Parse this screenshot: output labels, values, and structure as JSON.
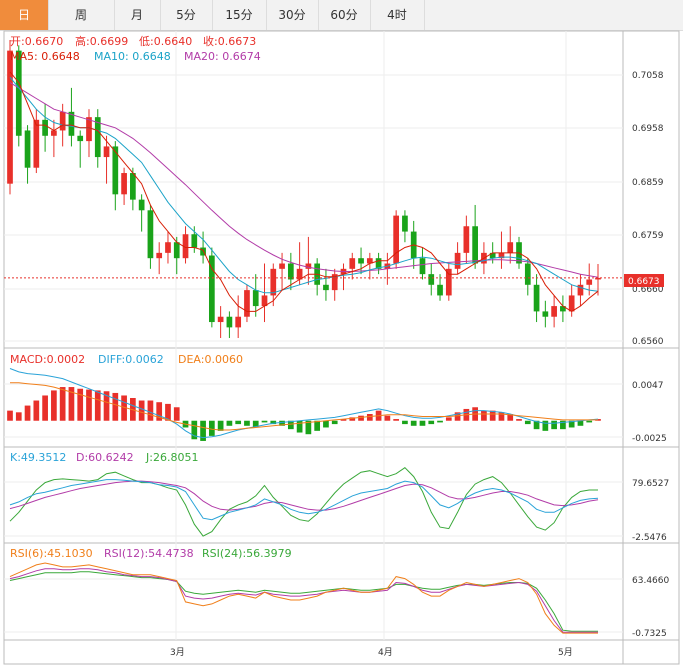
{
  "tabs": {
    "items": [
      "日",
      "周",
      "月",
      "5分",
      "15分",
      "30分",
      "60分",
      "4时"
    ],
    "active_index": 0
  },
  "colors": {
    "up": "#e8302a",
    "down": "#1aa31a",
    "active_tab": "#f08c3c",
    "ma5": "#d81e06",
    "ma10": "#1ba3c8",
    "ma20": "#b23ca8",
    "diff": "#2aa3d8",
    "dea": "#f07f1a",
    "k": "#2aa3d8",
    "d": "#b23ca8",
    "j": "#3aa83a",
    "rsi6": "#f07f1a",
    "rsi12": "#b23ca8",
    "rsi24": "#3aa83a"
  },
  "price_panel": {
    "labels": {
      "open": "开:0.6670",
      "high": "高:0.6699",
      "low": "低:0.6640",
      "close": "收:0.6673",
      "ma5": "MA5: 0.6648",
      "ma10": "MA10: 0.6648",
      "ma20": "MA20: 0.6674"
    },
    "y_ticks": [
      "0.7058",
      "0.6958",
      "0.6859",
      "0.6759",
      "0.6660",
      "0.6560"
    ],
    "current_price": "0.6673"
  },
  "macd_panel": {
    "labels": {
      "macd": "MACD:0.0002",
      "diff": "DIFF:0.0062",
      "dea": "DEA:0.0060"
    },
    "y_ticks": [
      "0.0047",
      "-0.0025"
    ]
  },
  "kdj_panel": {
    "labels": {
      "k": "K:49.3512",
      "d": "D:60.6242",
      "j": "J:26.8051"
    },
    "y_ticks": [
      "79.6527",
      "-2.5476"
    ]
  },
  "rsi_panel": {
    "labels": {
      "rsi6": "RSI(6):45.1030",
      "rsi12": "RSI(12):54.4738",
      "rsi24": "RSI(24):56.3979"
    },
    "y_ticks": [
      "63.4660",
      "-0.7325"
    ]
  },
  "x_axis": {
    "labels": [
      "3月",
      "4月",
      "5月"
    ]
  },
  "chart_data": {
    "type": "candlestick",
    "ylim": [
      0.6545,
      0.7135
    ],
    "ohlc": [
      [
        0.685,
        0.712,
        0.683,
        0.71
      ],
      [
        0.71,
        0.711,
        0.692,
        0.694
      ],
      [
        0.695,
        0.696,
        0.685,
        0.688
      ],
      [
        0.688,
        0.699,
        0.687,
        0.697
      ],
      [
        0.697,
        0.7,
        0.691,
        0.694
      ],
      [
        0.694,
        0.697,
        0.69,
        0.695
      ],
      [
        0.695,
        0.7,
        0.692,
        0.6985
      ],
      [
        0.6985,
        0.703,
        0.692,
        0.694
      ],
      [
        0.694,
        0.695,
        0.688,
        0.693
      ],
      [
        0.693,
        0.699,
        0.69,
        0.6975
      ],
      [
        0.6975,
        0.699,
        0.688,
        0.69
      ],
      [
        0.69,
        0.694,
        0.685,
        0.692
      ],
      [
        0.692,
        0.693,
        0.68,
        0.683
      ],
      [
        0.683,
        0.688,
        0.681,
        0.687
      ],
      [
        0.687,
        0.688,
        0.68,
        0.682
      ],
      [
        0.682,
        0.683,
        0.676,
        0.68
      ],
      [
        0.68,
        0.681,
        0.669,
        0.671
      ],
      [
        0.671,
        0.674,
        0.668,
        0.672
      ],
      [
        0.672,
        0.676,
        0.67,
        0.674
      ],
      [
        0.674,
        0.675,
        0.668,
        0.671
      ],
      [
        0.671,
        0.677,
        0.67,
        0.6755
      ],
      [
        0.6755,
        0.677,
        0.672,
        0.673
      ],
      [
        0.673,
        0.676,
        0.67,
        0.6715
      ],
      [
        0.6715,
        0.673,
        0.658,
        0.659
      ],
      [
        0.659,
        0.662,
        0.656,
        0.66
      ],
      [
        0.66,
        0.661,
        0.656,
        0.658
      ],
      [
        0.658,
        0.664,
        0.656,
        0.66
      ],
      [
        0.66,
        0.666,
        0.659,
        0.665
      ],
      [
        0.665,
        0.668,
        0.66,
        0.662
      ],
      [
        0.662,
        0.67,
        0.659,
        0.664
      ],
      [
        0.664,
        0.67,
        0.662,
        0.669
      ],
      [
        0.669,
        0.672,
        0.665,
        0.67
      ],
      [
        0.67,
        0.672,
        0.665,
        0.667
      ],
      [
        0.667,
        0.674,
        0.666,
        0.669
      ],
      [
        0.669,
        0.675,
        0.666,
        0.67
      ],
      [
        0.67,
        0.671,
        0.664,
        0.666
      ],
      [
        0.666,
        0.669,
        0.663,
        0.665
      ],
      [
        0.665,
        0.669,
        0.663,
        0.668
      ],
      [
        0.668,
        0.67,
        0.665,
        0.669
      ],
      [
        0.669,
        0.672,
        0.667,
        0.671
      ],
      [
        0.671,
        0.673,
        0.668,
        0.67
      ],
      [
        0.67,
        0.672,
        0.667,
        0.671
      ],
      [
        0.671,
        0.672,
        0.668,
        0.669
      ],
      [
        0.669,
        0.672,
        0.666,
        0.67
      ],
      [
        0.67,
        0.68,
        0.669,
        0.679
      ],
      [
        0.679,
        0.68,
        0.674,
        0.676
      ],
      [
        0.676,
        0.678,
        0.669,
        0.671
      ],
      [
        0.671,
        0.673,
        0.667,
        0.668
      ],
      [
        0.668,
        0.67,
        0.664,
        0.666
      ],
      [
        0.666,
        0.668,
        0.663,
        0.664
      ],
      [
        0.664,
        0.67,
        0.663,
        0.669
      ],
      [
        0.669,
        0.674,
        0.668,
        0.672
      ],
      [
        0.672,
        0.679,
        0.67,
        0.677
      ],
      [
        0.677,
        0.681,
        0.669,
        0.67
      ],
      [
        0.67,
        0.674,
        0.668,
        0.672
      ],
      [
        0.672,
        0.674,
        0.67,
        0.671
      ],
      [
        0.671,
        0.676,
        0.669,
        0.672
      ],
      [
        0.672,
        0.677,
        0.67,
        0.674
      ],
      [
        0.674,
        0.675,
        0.669,
        0.67
      ],
      [
        0.67,
        0.671,
        0.664,
        0.666
      ],
      [
        0.666,
        0.668,
        0.659,
        0.661
      ],
      [
        0.661,
        0.663,
        0.658,
        0.66
      ],
      [
        0.66,
        0.664,
        0.658,
        0.662
      ],
      [
        0.662,
        0.664,
        0.659,
        0.661
      ],
      [
        0.661,
        0.666,
        0.66,
        0.664
      ],
      [
        0.664,
        0.668,
        0.662,
        0.666
      ],
      [
        0.666,
        0.67,
        0.664,
        0.667
      ],
      [
        0.667,
        0.6699,
        0.664,
        0.6673
      ]
    ],
    "ma5": [
      0.706,
      0.704,
      0.7,
      0.696,
      0.696,
      0.695,
      0.696,
      0.696,
      0.6955,
      0.6955,
      0.695,
      0.693,
      0.691,
      0.689,
      0.687,
      0.685,
      0.681,
      0.678,
      0.676,
      0.674,
      0.673,
      0.673,
      0.6725,
      0.669,
      0.667,
      0.664,
      0.662,
      0.661,
      0.661,
      0.662,
      0.663,
      0.665,
      0.666,
      0.667,
      0.668,
      0.668,
      0.6675,
      0.6675,
      0.668,
      0.6685,
      0.669,
      0.67,
      0.6705,
      0.6705,
      0.672,
      0.673,
      0.6735,
      0.673,
      0.672,
      0.67,
      0.668,
      0.668,
      0.669,
      0.67,
      0.671,
      0.672,
      0.672,
      0.672,
      0.672,
      0.671,
      0.669,
      0.666,
      0.664,
      0.662,
      0.661,
      0.662,
      0.6635,
      0.6648
    ],
    "ma10": [
      0.705,
      0.703,
      0.701,
      0.699,
      0.6975,
      0.6965,
      0.696,
      0.6958,
      0.6955,
      0.6955,
      0.695,
      0.6945,
      0.6935,
      0.692,
      0.6905,
      0.689,
      0.6865,
      0.684,
      0.6815,
      0.6795,
      0.6775,
      0.676,
      0.6745,
      0.6725,
      0.6705,
      0.6685,
      0.667,
      0.666,
      0.665,
      0.6645,
      0.6645,
      0.665,
      0.6655,
      0.666,
      0.6665,
      0.667,
      0.6672,
      0.6675,
      0.6678,
      0.668,
      0.6683,
      0.6688,
      0.6692,
      0.6695,
      0.67,
      0.6705,
      0.671,
      0.6712,
      0.671,
      0.6705,
      0.67,
      0.6698,
      0.67,
      0.6702,
      0.6705,
      0.671,
      0.6712,
      0.6712,
      0.671,
      0.6705,
      0.67,
      0.669,
      0.668,
      0.667,
      0.666,
      0.6655,
      0.665,
      0.6648
    ],
    "ma20": [
      0.704,
      0.703,
      0.702,
      0.701,
      0.7,
      0.699,
      0.6985,
      0.698,
      0.6975,
      0.697,
      0.6965,
      0.696,
      0.6955,
      0.6945,
      0.6935,
      0.6922,
      0.6908,
      0.6893,
      0.6878,
      0.6863,
      0.6848,
      0.6832,
      0.6816,
      0.68,
      0.6785,
      0.677,
      0.6757,
      0.6745,
      0.6735,
      0.6725,
      0.6716,
      0.6708,
      0.6702,
      0.6697,
      0.6693,
      0.669,
      0.6688,
      0.6686,
      0.6685,
      0.6685,
      0.6686,
      0.6687,
      0.6688,
      0.669,
      0.6692,
      0.6694,
      0.6696,
      0.6698,
      0.67,
      0.6701,
      0.6702,
      0.6703,
      0.6704,
      0.6705,
      0.6706,
      0.6707,
      0.6707,
      0.6706,
      0.6705,
      0.6703,
      0.67,
      0.6696,
      0.6692,
      0.6688,
      0.6684,
      0.668,
      0.6677,
      0.6674
    ],
    "macd_hist": [
      0.0012,
      0.001,
      0.0018,
      0.0024,
      0.003,
      0.0036,
      0.004,
      0.004,
      0.0038,
      0.0037,
      0.0036,
      0.0035,
      0.0033,
      0.003,
      0.0027,
      0.0024,
      0.0024,
      0.0022,
      0.002,
      0.0016,
      -0.0008,
      -0.0022,
      -0.0024,
      -0.0018,
      -0.0012,
      -0.0006,
      -0.0004,
      -0.0006,
      -0.0008,
      -0.0002,
      -0.0004,
      -0.0006,
      -0.001,
      -0.0014,
      -0.0016,
      -0.0012,
      -0.0008,
      -0.0004,
      0.0002,
      0.0004,
      0.0006,
      0.0008,
      0.0012,
      0.0006,
      0.0002,
      -0.0004,
      -0.0006,
      -0.0006,
      -0.0004,
      -0.0002,
      0.0004,
      0.001,
      0.0014,
      0.0016,
      0.0012,
      0.0012,
      0.001,
      0.0008,
      0.0002,
      -0.0004,
      -0.001,
      -0.0012,
      -0.001,
      -0.001,
      -0.0008,
      -0.0006,
      -0.0002,
      0.0002
    ],
    "diff": [
      0.0062,
      0.0058,
      0.0056,
      0.0055,
      0.0054,
      0.0052,
      0.005,
      0.0046,
      0.0042,
      0.0038,
      0.0034,
      0.003,
      0.0026,
      0.0022,
      0.0018,
      0.0014,
      0.001,
      0.0006,
      0.0002,
      -0.0004,
      -0.0012,
      -0.0018,
      -0.002,
      -0.0019,
      -0.0017,
      -0.0014,
      -0.0011,
      -0.0009,
      -0.0007,
      -0.0005,
      -0.0003,
      -0.0002,
      -0.0001,
      0.0,
      0.0001,
      0.0002,
      0.0003,
      0.0004,
      0.0006,
      0.0008,
      0.001,
      0.0012,
      0.0014,
      0.0012,
      0.0009,
      0.0006,
      0.0004,
      0.0003,
      0.0003,
      0.0004,
      0.0006,
      0.0008,
      0.001,
      0.0012,
      0.0012,
      0.0011,
      0.001,
      0.0008,
      0.0005,
      0.0002,
      -0.0001,
      -0.0003,
      -0.0003,
      -0.0002,
      -0.0001,
      0.0,
      0.0001,
      0.0002
    ],
    "dea": [
      0.0045,
      0.0045,
      0.0044,
      0.0043,
      0.0042,
      0.004,
      0.0037,
      0.0034,
      0.0031,
      0.0028,
      0.0025,
      0.0022,
      0.0019,
      0.0016,
      0.0013,
      0.001,
      0.0007,
      0.0004,
      0.0001,
      -0.0002,
      -0.0004,
      -0.0006,
      -0.0008,
      -0.001,
      -0.0011,
      -0.0011,
      -0.001,
      -0.0009,
      -0.0008,
      -0.0007,
      -0.0006,
      -0.0005,
      -0.0004,
      -0.0003,
      -0.0002,
      -0.0001,
      0.0,
      0.0001,
      0.0002,
      0.0003,
      0.0004,
      0.0005,
      0.0006,
      0.0007,
      0.0007,
      0.0007,
      0.0006,
      0.0005,
      0.0005,
      0.0005,
      0.0005,
      0.0006,
      0.0007,
      0.0008,
      0.0008,
      0.0008,
      0.0008,
      0.0007,
      0.0006,
      0.0005,
      0.0004,
      0.0003,
      0.0002,
      0.0001,
      0.0001,
      0.0001,
      0.0001,
      0.0001
    ],
    "macd_ylim": [
      -0.003,
      0.0065
    ],
    "k": [
      40,
      44,
      50,
      55,
      57,
      60,
      63,
      66,
      68,
      70,
      72,
      74,
      74,
      73,
      72,
      71,
      70,
      67,
      66,
      64,
      58,
      40,
      22,
      20,
      25,
      30,
      33,
      36,
      40,
      48,
      44,
      40,
      34,
      30,
      28,
      30,
      34,
      40,
      46,
      52,
      56,
      58,
      60,
      62,
      68,
      72,
      70,
      64,
      52,
      40,
      36,
      42,
      50,
      56,
      60,
      62,
      60,
      56,
      50,
      44,
      34,
      30,
      30,
      36,
      42,
      46,
      48,
      49
    ],
    "d": [
      35,
      38,
      42,
      46,
      50,
      53,
      56,
      59,
      62,
      64,
      66,
      68,
      70,
      71,
      72,
      72,
      71,
      70,
      68,
      66,
      63,
      55,
      45,
      38,
      34,
      33,
      34,
      36,
      38,
      42,
      44,
      43,
      40,
      37,
      34,
      33,
      33,
      35,
      38,
      42,
      46,
      50,
      54,
      58,
      62,
      66,
      68,
      67,
      63,
      57,
      51,
      48,
      48,
      50,
      53,
      56,
      58,
      58,
      56,
      53,
      48,
      44,
      40,
      39,
      40,
      42,
      45,
      47
    ],
    "j": [
      18,
      30,
      45,
      60,
      70,
      74,
      75,
      74,
      73,
      72,
      74,
      82,
      84,
      79,
      74,
      70,
      70,
      67,
      63,
      60,
      40,
      14,
      -2,
      4,
      20,
      34,
      40,
      44,
      52,
      66,
      50,
      38,
      26,
      20,
      18,
      28,
      42,
      56,
      68,
      76,
      84,
      86,
      82,
      78,
      82,
      90,
      78,
      58,
      30,
      10,
      8,
      30,
      54,
      68,
      74,
      78,
      70,
      56,
      40,
      24,
      10,
      6,
      16,
      36,
      50,
      58,
      60,
      60
    ],
    "kdj_ylim": [
      -10,
      95
    ],
    "rsi6": [
      60,
      64,
      68,
      72,
      74,
      72,
      70,
      70,
      71,
      72,
      70,
      68,
      66,
      64,
      62,
      62,
      62,
      60,
      58,
      56,
      34,
      32,
      30,
      32,
      36,
      40,
      42,
      40,
      38,
      44,
      40,
      38,
      36,
      36,
      38,
      40,
      44,
      46,
      48,
      46,
      44,
      44,
      46,
      48,
      60,
      58,
      52,
      44,
      40,
      40,
      46,
      50,
      54,
      52,
      50,
      52,
      54,
      56,
      58,
      54,
      42,
      22,
      10,
      2,
      2,
      2,
      2,
      2
    ],
    "rsi12": [
      58,
      60,
      63,
      66,
      68,
      68,
      67,
      67,
      68,
      68,
      67,
      65,
      64,
      62,
      61,
      60,
      60,
      59,
      57,
      55,
      40,
      38,
      37,
      38,
      40,
      42,
      43,
      42,
      41,
      44,
      42,
      41,
      40,
      40,
      41,
      42,
      44,
      45,
      46,
      45,
      44,
      44,
      45,
      46,
      54,
      53,
      50,
      46,
      44,
      44,
      47,
      50,
      52,
      51,
      50,
      51,
      52,
      53,
      54,
      52,
      45,
      30,
      15,
      3,
      3,
      3,
      3,
      3
    ],
    "rsi24": [
      56,
      58,
      60,
      62,
      64,
      64,
      64,
      64,
      65,
      65,
      64,
      63,
      62,
      61,
      60,
      59,
      59,
      58,
      57,
      55,
      45,
      43,
      42,
      43,
      44,
      45,
      46,
      45,
      44,
      46,
      45,
      44,
      43,
      43,
      44,
      45,
      46,
      47,
      48,
      47,
      46,
      46,
      47,
      48,
      52,
      52,
      50,
      48,
      47,
      47,
      49,
      51,
      52,
      52,
      51,
      52,
      53,
      54,
      54,
      53,
      48,
      36,
      22,
      5,
      4,
      4,
      4,
      4
    ],
    "rsi_ylim": [
      -3,
      75
    ]
  }
}
